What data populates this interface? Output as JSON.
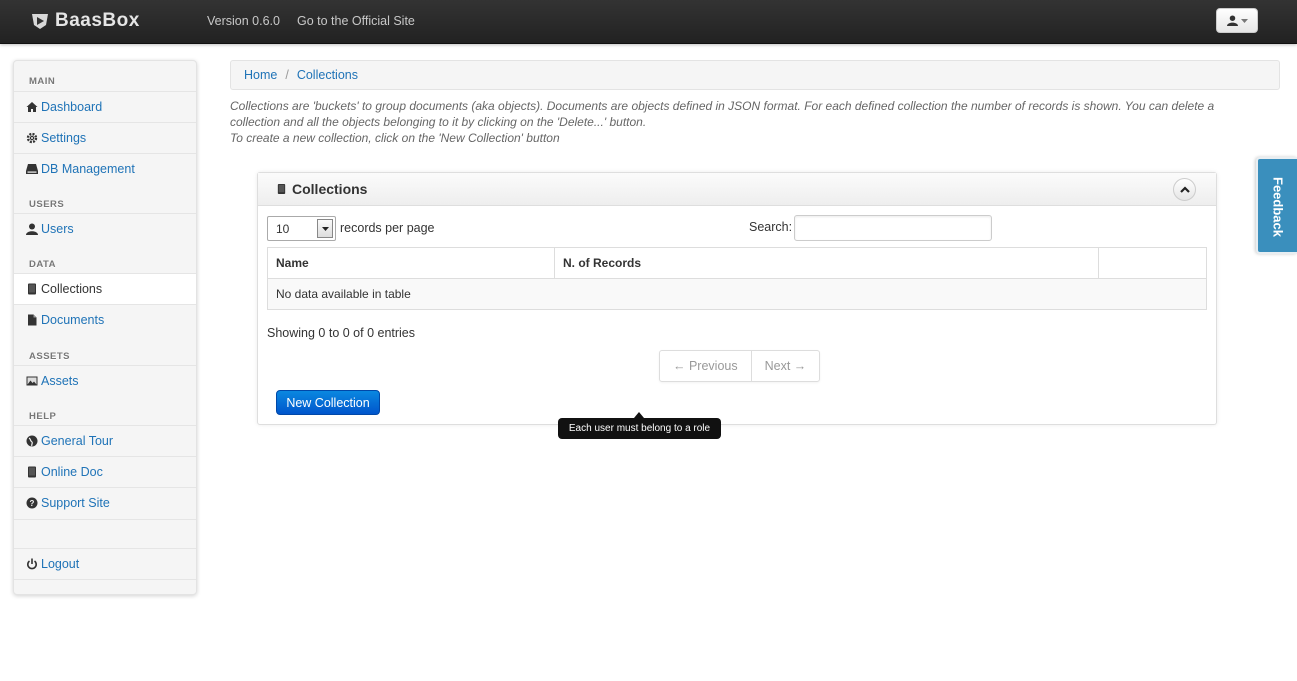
{
  "navbar": {
    "brand": "BaasBox",
    "version": "Version 0.6.0",
    "official_link": "Go to the Official Site"
  },
  "sidebar": {
    "sections": {
      "main": "MAIN",
      "users": "USERS",
      "data": "DATA",
      "assets": "ASSETS",
      "help": "HELP"
    },
    "items": {
      "dashboard": "Dashboard",
      "settings": "Settings",
      "db_management": "DB Management",
      "users": "Users",
      "collections": "Collections",
      "documents": "Documents",
      "assets": "Assets",
      "general_tour": "General Tour",
      "online_doc": "Online Doc",
      "support_site": "Support Site",
      "logout": "Logout"
    },
    "active_item": "Collections"
  },
  "breadcrumb": {
    "home": "Home",
    "separator": "/",
    "current": "Collections"
  },
  "intro": {
    "line1": "Collections are 'buckets' to group documents (aka objects). Documents are objects defined in JSON format. For each defined collection the number of records is shown. You can delete a collection and all the objects belonging to it by clicking on the 'Delete...' button.",
    "line2": "To create a new collection, click on the 'New Collection' button"
  },
  "panel": {
    "title": "Collections",
    "page_length": "10",
    "page_length_label": "records per page",
    "search_label": "Search:",
    "search_value": "",
    "columns": [
      "Name",
      "N. of Records",
      ""
    ],
    "empty_message": "No data available in table",
    "info": "Showing 0 to 0 of 0 entries",
    "prev": "← Previous",
    "next": "Next →",
    "new_button": "New Collection"
  },
  "tooltip": "Each user must belong to a role",
  "feedback": "Feedback",
  "colors": {
    "navbar": "#222222",
    "link": "#1f73b7",
    "primary_button": "#0074cc",
    "feedback_tab": "#3a8fbd"
  }
}
